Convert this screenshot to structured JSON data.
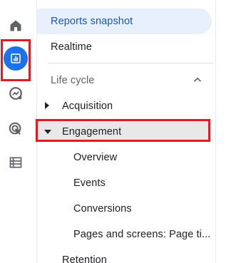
{
  "rail": {
    "items": [
      {
        "icon": "home-icon",
        "active": false
      },
      {
        "icon": "reports-bar-chart-icon",
        "active": true
      },
      {
        "icon": "explore-icon",
        "active": false
      },
      {
        "icon": "advertising-icon",
        "active": false
      },
      {
        "icon": "configure-list-icon",
        "active": false
      }
    ],
    "active_color": "#1a73e8"
  },
  "nav": {
    "reports_snapshot": "Reports snapshot",
    "realtime": "Realtime",
    "section_title": "Life cycle",
    "section_expanded": true,
    "groups": [
      {
        "label": "Acquisition",
        "expanded": false
      },
      {
        "label": "Engagement",
        "expanded": true,
        "children": [
          "Overview",
          "Events",
          "Conversions",
          "Pages and screens: Page ti..."
        ]
      },
      {
        "label": "Retention",
        "expanded": false
      }
    ]
  },
  "annotations": {
    "highlight_color": "#e01b24"
  }
}
